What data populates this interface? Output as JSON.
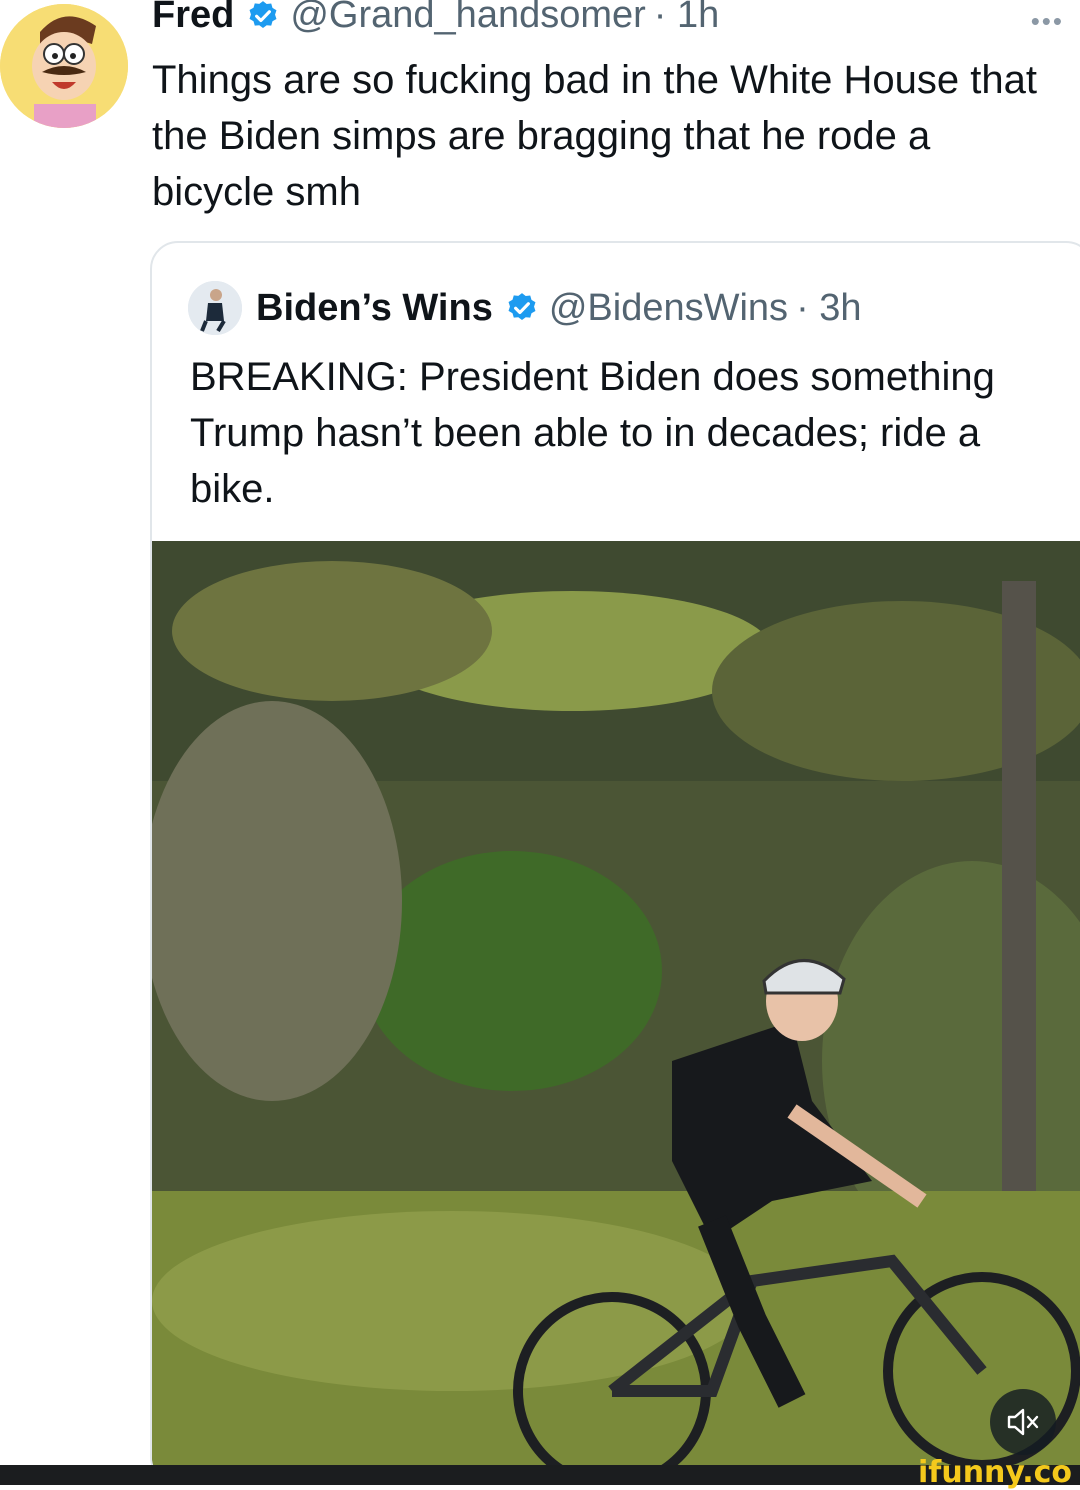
{
  "tweet": {
    "display_name": "Fred",
    "handle": "@Grand_handsomer",
    "time": "· 1h",
    "text": "Things are so fucking bad in the White House that the Biden simps are bragging that he rode a bicycle smh",
    "more_label": "•••"
  },
  "quote": {
    "display_name": "Biden’s Wins",
    "handle": "@BidensWins",
    "time": "· 3h",
    "text": "BREAKING: President Biden does something Trump hasn’t been able to in decades; ride a bike."
  },
  "media": {
    "mute_icon": "speaker-muted-icon"
  },
  "watermark": "ifunny.co",
  "colors": {
    "verified": "#1d9bf0",
    "handle": "#536471",
    "watermark": "#f4c91c"
  }
}
